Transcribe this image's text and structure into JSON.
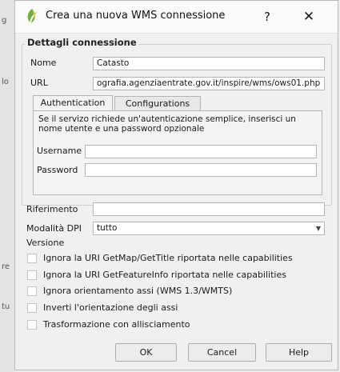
{
  "background": {
    "fragments": [
      "g",
      "lo",
      "re",
      "tu"
    ]
  },
  "title_bar": {
    "title": "Crea una nuova WMS connessione",
    "help_label": "?",
    "close_label": "✕"
  },
  "connection": {
    "group_title": "Dettagli connessione",
    "name_label": "Nome",
    "name_value": "Catasto",
    "url_label": "URL",
    "url_value": "ografia.agenziaentrate.gov.it/inspire/wms/ows01.php"
  },
  "tabs": {
    "authentication": "Authentication",
    "configurations": "Configurations"
  },
  "auth": {
    "info": "Se il servizo richiede un'autenticazione semplice, inserisci un nome utente e una password opzionale",
    "username_label": "Username",
    "username_value": "",
    "password_label": "Password",
    "password_value": ""
  },
  "referer": {
    "label": "Riferimento",
    "value": ""
  },
  "dpi": {
    "label": "Modalità DPI",
    "value": "tutto"
  },
  "version_label": "Versione",
  "options": [
    {
      "label": "Ignora la URI GetMap/GetTitle riportata nelle capabilities",
      "checked": false
    },
    {
      "label": "Ignora la URI GetFeatureInfo riportata nelle capabilities",
      "checked": false
    },
    {
      "label": "Ignora orientamento assi (WMS 1.3/WMTS)",
      "checked": false
    },
    {
      "label": "Inverti l'orientazione degli assi",
      "checked": false
    },
    {
      "label": "Trasformazione con allisciamento",
      "checked": false
    }
  ],
  "buttons": {
    "ok": "OK",
    "cancel": "Cancel",
    "help": "Help"
  },
  "colors": {
    "dialog_bg": "#f0f0f0",
    "titlebar_bg": "#fafafa",
    "border": "#b5b5b5"
  }
}
